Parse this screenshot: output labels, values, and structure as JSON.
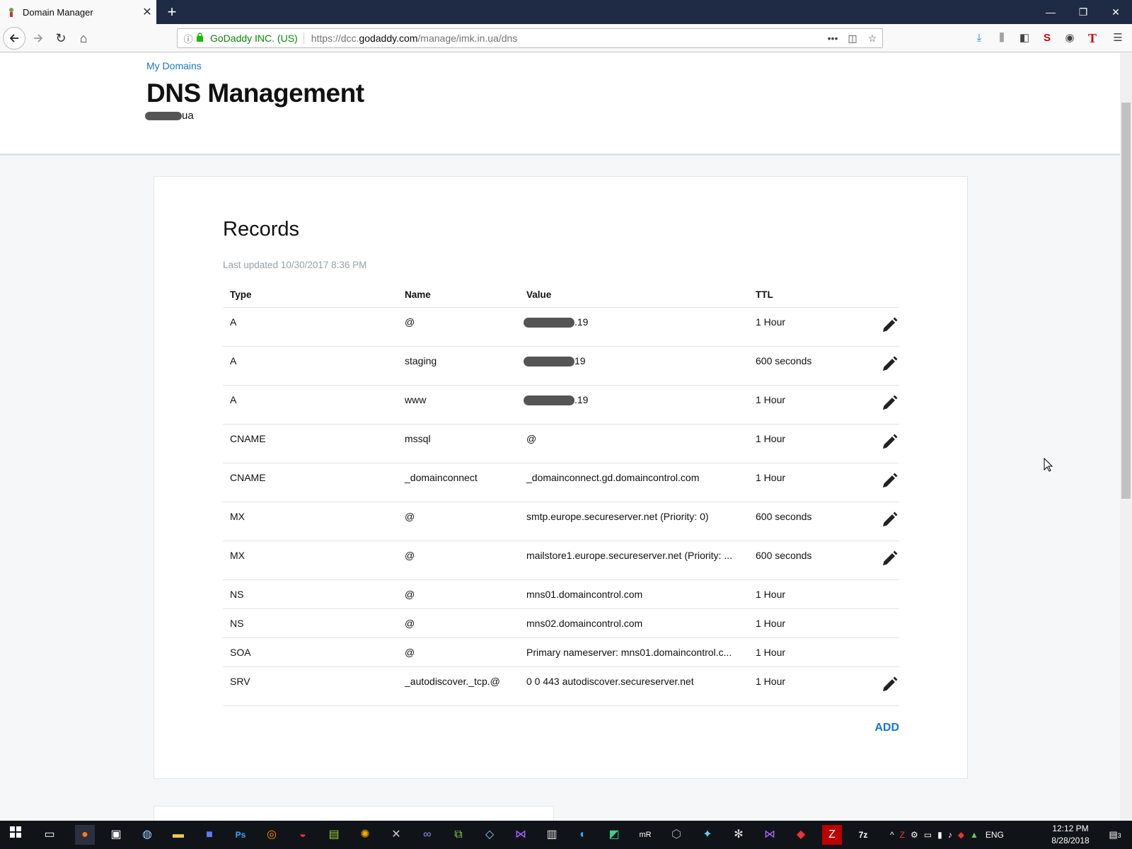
{
  "browser": {
    "tab_title": "Domain Manager",
    "identity": "GoDaddy INC. (US)",
    "url_prefix": "https://dcc.",
    "url_domain": "godaddy.com",
    "url_path": "/manage/imk.in.ua/dns"
  },
  "page": {
    "breadcrumb": "My Domains",
    "title": "DNS Management",
    "domain_suffix": "ua"
  },
  "records": {
    "heading": "Records",
    "last_updated": "Last updated 10/30/2017 8:36 PM",
    "columns": [
      "Type",
      "Name",
      "Value",
      "TTL"
    ],
    "rows": [
      {
        "type": "A",
        "name": "@",
        "value": ".19",
        "ttl": "1 Hour",
        "editable": true,
        "redacted": true
      },
      {
        "type": "A",
        "name": "staging",
        "value": "19",
        "ttl": "600 seconds",
        "editable": true,
        "redacted": true
      },
      {
        "type": "A",
        "name": "www",
        "value": ".19",
        "ttl": "1 Hour",
        "editable": true,
        "redacted": true
      },
      {
        "type": "CNAME",
        "name": "mssql",
        "value": "@",
        "ttl": "1 Hour",
        "editable": true
      },
      {
        "type": "CNAME",
        "name": "_domainconnect",
        "value": "_domainconnect.gd.domaincontrol.com",
        "ttl": "1 Hour",
        "editable": true
      },
      {
        "type": "MX",
        "name": "@",
        "value": "smtp.europe.secureserver.net (Priority: 0)",
        "ttl": "600 seconds",
        "editable": true
      },
      {
        "type": "MX",
        "name": "@",
        "value": "mailstore1.europe.secureserver.net (Priority: ...",
        "ttl": "600 seconds",
        "editable": true
      },
      {
        "type": "NS",
        "name": "@",
        "value": "mns01.domaincontrol.com",
        "ttl": "1 Hour",
        "editable": false
      },
      {
        "type": "NS",
        "name": "@",
        "value": "mns02.domaincontrol.com",
        "ttl": "1 Hour",
        "editable": false
      },
      {
        "type": "SOA",
        "name": "@",
        "value": "Primary nameserver: mns01.domaincontrol.c...",
        "ttl": "1 Hour",
        "editable": false
      },
      {
        "type": "SRV",
        "name": "_autodiscover._tcp.@",
        "value": "0 0 443 autodiscover.secureserver.net",
        "ttl": "1 Hour",
        "editable": true
      }
    ],
    "add_label": "ADD"
  },
  "taskbar": {
    "language": "ENG",
    "time": "12:12 PM",
    "date": "8/28/2018",
    "notification_count": "3"
  },
  "colors": {
    "link": "#1976d2",
    "secure": "#058b00",
    "tabbar": "#1f2a44"
  }
}
